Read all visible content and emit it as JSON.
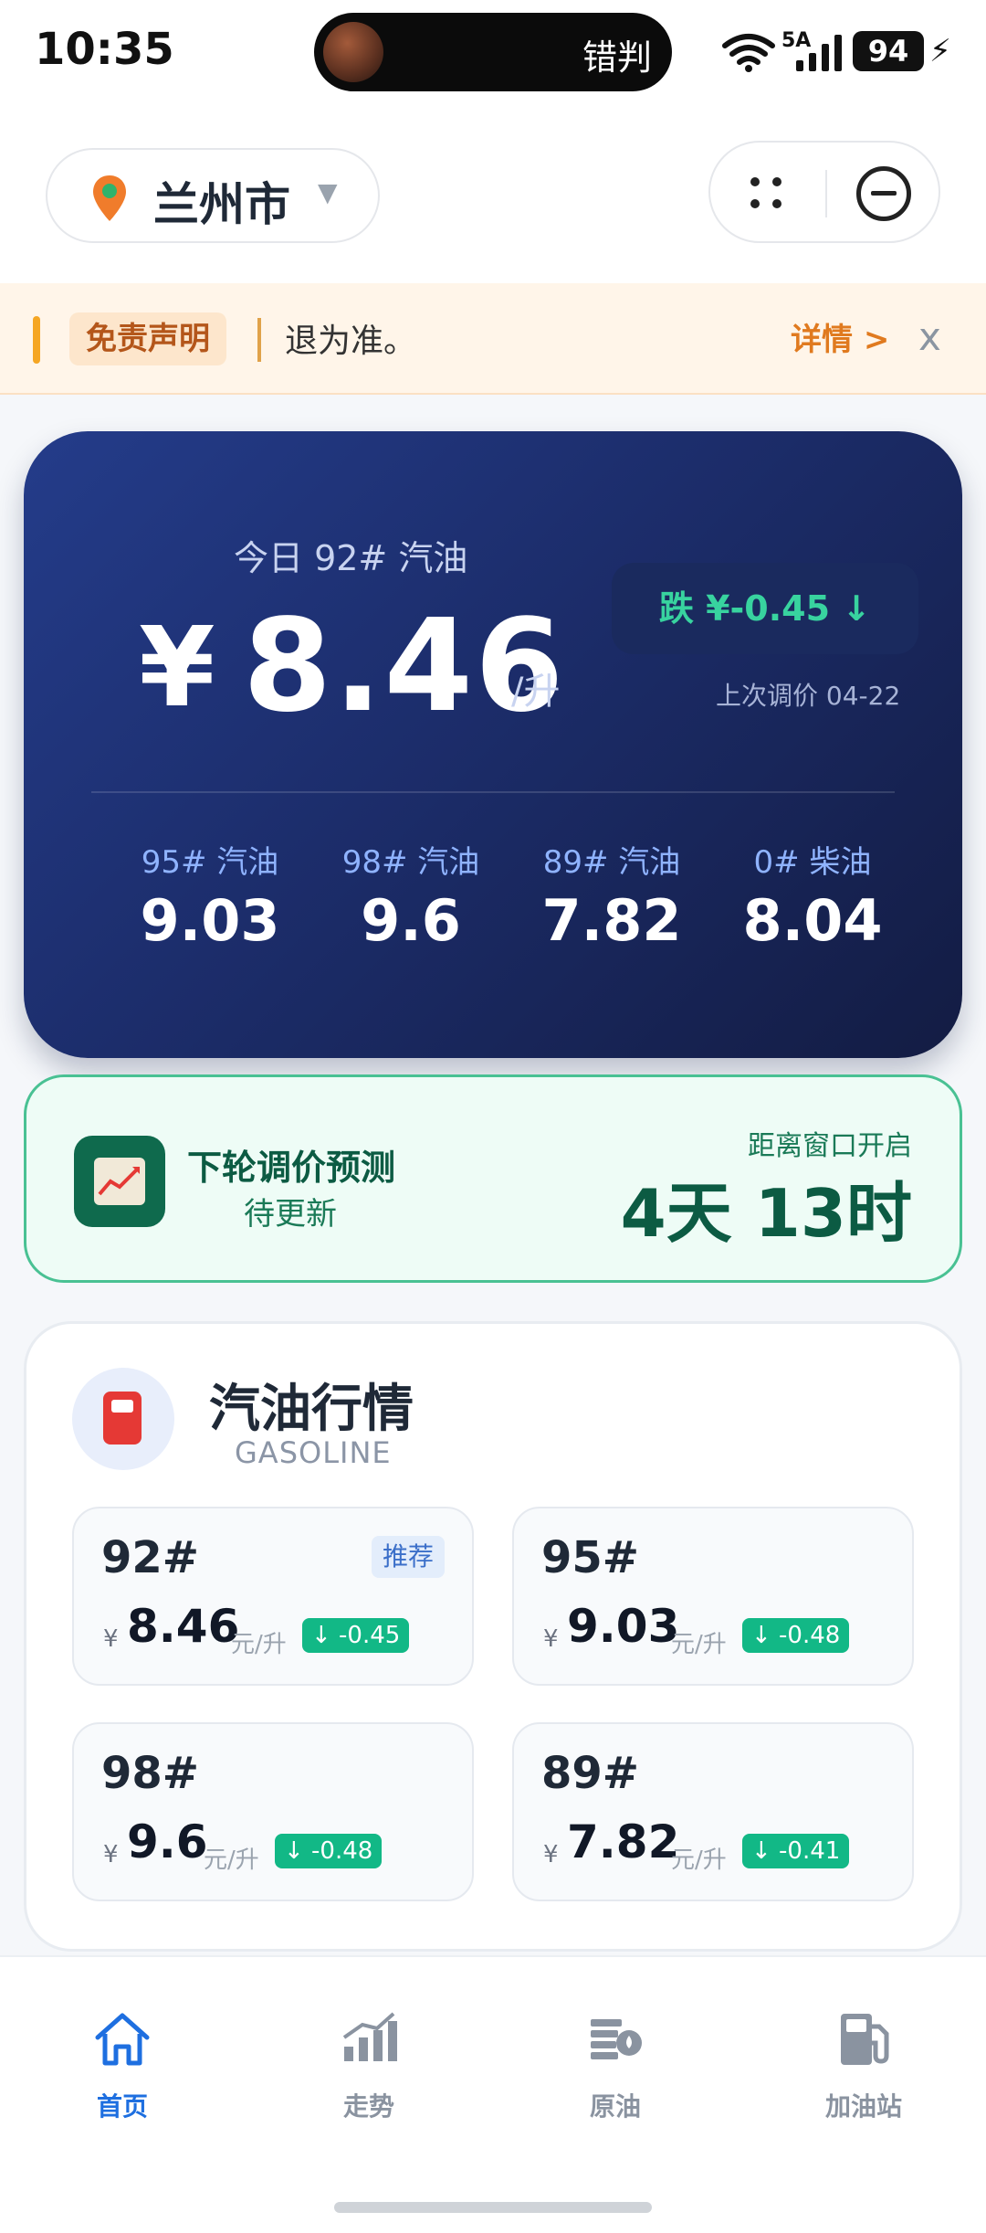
{
  "status_bar": {
    "time": "10:35",
    "island_text": "错判",
    "network": "5A",
    "battery": "94"
  },
  "header": {
    "city": "兰州市",
    "icons": [
      "location-pin-icon",
      "chevron-down-icon",
      "more-dots-icon",
      "close-circle-icon"
    ]
  },
  "notice": {
    "tag": "免责声明",
    "text": "退为准。",
    "more": "详情 >",
    "close": "x"
  },
  "price_card": {
    "label": "今日 92# 汽油",
    "currency": "¥",
    "price": "8.46",
    "unit": "/升",
    "change": "跌 ¥-0.45 ↓",
    "last_adjust": "上次调价 04-22",
    "others": [
      {
        "label": "95# 汽油",
        "value": "9.03"
      },
      {
        "label": "98# 汽油",
        "value": "9.6"
      },
      {
        "label": "89# 汽油",
        "value": "7.82"
      },
      {
        "label": "0# 柴油",
        "value": "8.04"
      }
    ]
  },
  "forecast": {
    "title": "下轮调价预测",
    "status": "待更新",
    "label": "距离窗口开启",
    "countdown": "4天 13时"
  },
  "gasoline": {
    "title": "汽油行情",
    "subtitle": "GASOLINE",
    "cards": [
      {
        "grade": "92#",
        "badge": "推荐",
        "currency": "¥",
        "price": "8.46",
        "unit": "元/升",
        "delta": "↓ -0.45"
      },
      {
        "grade": "95#",
        "badge": "",
        "currency": "¥",
        "price": "9.03",
        "unit": "元/升",
        "delta": "↓ -0.48"
      },
      {
        "grade": "98#",
        "badge": "",
        "currency": "¥",
        "price": "9.6",
        "unit": "元/升",
        "delta": "↓ -0.48"
      },
      {
        "grade": "89#",
        "badge": "",
        "currency": "¥",
        "price": "7.82",
        "unit": "元/升",
        "delta": "↓ -0.41"
      }
    ]
  },
  "tabbar": {
    "items": [
      {
        "label": "首页",
        "icon": "home-icon",
        "active": true
      },
      {
        "label": "走势",
        "icon": "trend-chart-icon",
        "active": false
      },
      {
        "label": "原油",
        "icon": "oil-barrel-icon",
        "active": false
      },
      {
        "label": "加油站",
        "icon": "gas-station-icon",
        "active": false
      }
    ]
  },
  "colors": {
    "accent": "#1e6fe0",
    "card_dark": "#1c2d6b",
    "drop_green": "#12b886",
    "forecast_green": "#0c5b43",
    "notice_orange": "#e07a1f"
  }
}
